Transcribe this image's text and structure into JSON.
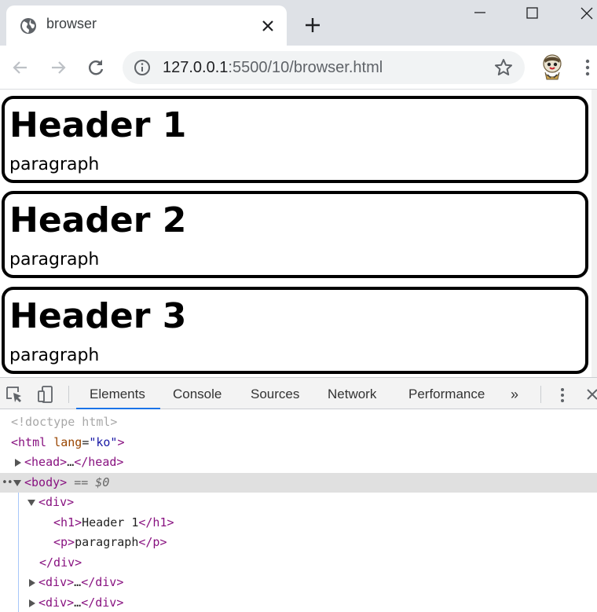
{
  "browser": {
    "tab": {
      "title": "browser",
      "icon": "globe-icon"
    },
    "address": {
      "host": "127.0.0.1",
      "path": ":5500/10/browser.html"
    }
  },
  "page": {
    "cards": [
      {
        "heading": "Header 1",
        "text": "paragraph"
      },
      {
        "heading": "Header 2",
        "text": "paragraph"
      },
      {
        "heading": "Header 3",
        "text": "paragraph"
      }
    ]
  },
  "devtools": {
    "tabs": [
      "Elements",
      "Console",
      "Sources",
      "Network",
      "Performance"
    ],
    "active_tab": "Elements",
    "more_label": "»",
    "tree": {
      "doctype": "<!doctype html>",
      "html_open": "<html",
      "html_attr": "lang",
      "html_eq": "=",
      "html_val": "\"ko\"",
      "html_close": ">",
      "head": "<head>",
      "head_ellipsis": "…",
      "head_end": "</head>",
      "body_open": "<body>",
      "body_eq": "== $0",
      "div_open": "<div>",
      "h1_open": "<h1>",
      "h1_text": "Header 1",
      "h1_close": "</h1>",
      "p_open": "<p>",
      "p_text": "paragraph",
      "p_close": "</p>",
      "div_close": "</div>",
      "div2_open": "<div>",
      "div2_ellipsis": "…",
      "div2_close": "</div>",
      "div3_open": "<div>",
      "div3_ellipsis": "…",
      "div3_close": "</div>"
    }
  },
  "colors": {
    "tabstrip": "#dee1e6",
    "omnibox": "#f1f3f4",
    "devtools_active": "#1a73e8",
    "tag": "#881280",
    "attr": "#994500",
    "value": "#1a1aa6"
  }
}
